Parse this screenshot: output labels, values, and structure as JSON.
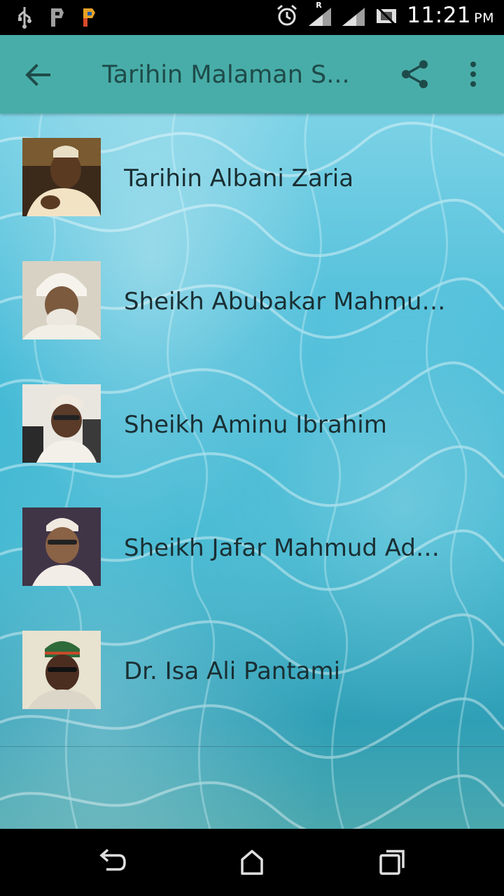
{
  "status_bar": {
    "time": "11:21",
    "ampm": "PM",
    "left_icons": [
      "usb-icon",
      "p-app-icon",
      "colored-app-icon"
    ],
    "right_icons": [
      "alarm-icon",
      "signal-roaming-icon",
      "signal-icon",
      "no-sim-icon"
    ],
    "roaming_mark": "R"
  },
  "app_bar": {
    "title": "Tarihin Malaman S...",
    "back_icon": "arrow-back-icon",
    "share_icon": "share-icon",
    "more_icon": "more-vert-icon"
  },
  "list": {
    "items": [
      {
        "label": "Tarihin Albani Zaria",
        "thumb_colors": [
          "#caa35a",
          "#3b2a1a",
          "#f3e6c8"
        ]
      },
      {
        "label": "Sheikh Abubakar Mahmud...",
        "thumb_colors": [
          "#f4efe2",
          "#7b5a3e",
          "#e2ddd2"
        ]
      },
      {
        "label": "Sheikh Aminu Ibrahim",
        "thumb_colors": [
          "#e9e6e0",
          "#5a3a28",
          "#2a2a2a"
        ]
      },
      {
        "label": "Sheikh Jafar Mahmud Adam",
        "thumb_colors": [
          "#5a3b2b",
          "#8a6246",
          "#f2ede6"
        ]
      },
      {
        "label": "Dr. Isa Ali Pantami",
        "thumb_colors": [
          "#e8e2d0",
          "#4b2e20",
          "#2e6a3a"
        ]
      }
    ]
  },
  "nav_bar": {
    "back_icon": "nav-back-icon",
    "home_icon": "nav-home-icon",
    "recents_icon": "nav-recents-icon"
  },
  "colors": {
    "app_bar": "#48ada8",
    "title_text": "#1e4b4a",
    "list_text": "#1a2f33",
    "status_bar": "#000000",
    "nav_bar": "#000000"
  }
}
